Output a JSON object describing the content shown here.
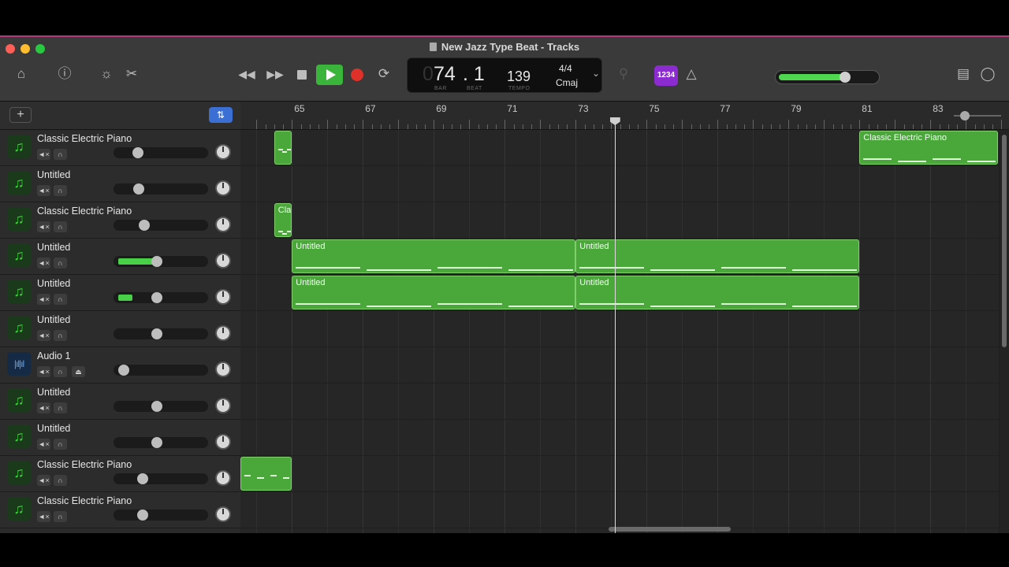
{
  "window": {
    "title": "New Jazz Type Beat - Tracks",
    "traffic_colors": [
      "#ff5f57",
      "#febc2e",
      "#28c840"
    ]
  },
  "toolbar": {
    "icons": [
      "library-icon",
      "help-icon",
      "smart-controls-icon",
      "scissors-icon",
      "rewind-icon",
      "fast-forward-icon",
      "stop-icon",
      "play-icon",
      "record-icon",
      "cycle-icon",
      "tuner-icon",
      "count-in-icon",
      "metronome-icon",
      "notepad-icon",
      "loop-browser-icon"
    ],
    "count_in_label": "1234"
  },
  "lcd": {
    "bar": "74",
    "beat": ". 1",
    "bar_label": "BAR",
    "beat_label": "BEAT",
    "tempo": "139",
    "tempo_label": "TEMPO",
    "time_signature": "4/4",
    "key": "Cmaj"
  },
  "master_volume": {
    "level": 0.68,
    "color": "#4fd84f"
  },
  "track_header": {
    "add_label": "+",
    "filter_label": "⇅"
  },
  "ruler": {
    "bars": [
      "65",
      "67",
      "69",
      "71",
      "73",
      "75",
      "77",
      "79",
      "81",
      "83"
    ]
  },
  "tracks": [
    {
      "name": "Classic Electric Piano",
      "type": "software",
      "volume": 0.2,
      "meter": 0
    },
    {
      "name": "Untitled",
      "type": "software",
      "volume": 0.21,
      "meter": 0
    },
    {
      "name": "Classic Electric Piano",
      "type": "software",
      "volume": 0.27,
      "meter": 0
    },
    {
      "name": "Untitled",
      "type": "software",
      "volume": 0.4,
      "meter": 0.45
    },
    {
      "name": "Untitled",
      "type": "software",
      "volume": 0.4,
      "meter": 0.15
    },
    {
      "name": "Untitled",
      "type": "software",
      "volume": 0.4,
      "meter": 0
    },
    {
      "name": "Audio 1",
      "type": "audio",
      "volume": 0.05,
      "meter": 0
    },
    {
      "name": "Untitled",
      "type": "software",
      "volume": 0.4,
      "meter": 0
    },
    {
      "name": "Untitled",
      "type": "software",
      "volume": 0.4,
      "meter": 0
    },
    {
      "name": "Classic Electric Piano",
      "type": "software",
      "volume": 0.25,
      "meter": 0
    },
    {
      "name": "Classic Electric Piano",
      "type": "software",
      "volume": 0.25,
      "meter": 0
    }
  ],
  "regions": [
    {
      "track": 0,
      "label": "",
      "start_bar": 64.5,
      "end_bar": 65.0
    },
    {
      "track": 0,
      "label": "Classic Electric Piano",
      "start_bar": 81.0,
      "end_bar": 84.9
    },
    {
      "track": 2,
      "label": "Classic",
      "start_bar": 64.5,
      "end_bar": 65.0
    },
    {
      "track": 3,
      "label": "Untitled",
      "start_bar": 65.0,
      "end_bar": 73.0
    },
    {
      "track": 3,
      "label": "Untitled",
      "start_bar": 73.0,
      "end_bar": 81.0
    },
    {
      "track": 4,
      "label": "Untitled",
      "start_bar": 65.0,
      "end_bar": 73.0
    },
    {
      "track": 4,
      "label": "Untitled",
      "start_bar": 73.0,
      "end_bar": 81.0
    },
    {
      "track": 9,
      "label": "",
      "start_bar": 63.5,
      "end_bar": 65.0
    }
  ],
  "playhead_bar": 74.1,
  "accent_color": "#4aa83a"
}
